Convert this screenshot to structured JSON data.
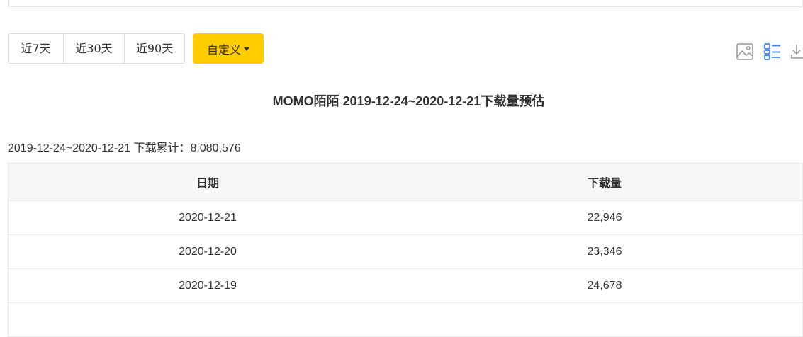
{
  "range_buttons": [
    "近7天",
    "近30天",
    "近90天"
  ],
  "custom_button": {
    "label": "自定义"
  },
  "toolbar": {
    "icons": [
      "image-icon",
      "list-view-icon",
      "download-icon"
    ],
    "active_color": "#3b82f6",
    "icon_color": "#999999"
  },
  "title": "MOMO陌陌 2019-12-24~2020-12-21下载量预估",
  "summary": "2019-12-24~2020-12-21 下载累计：8,080,576",
  "table": {
    "headers": [
      "日期",
      "下载量"
    ],
    "rows": [
      {
        "date": "2020-12-21",
        "downloads": "22,946"
      },
      {
        "date": "2020-12-20",
        "downloads": "23,346"
      },
      {
        "date": "2020-12-19",
        "downloads": "24,678"
      },
      {
        "date": "",
        "downloads": ""
      }
    ]
  },
  "colors": {
    "accent": "#ffcc00",
    "header_bg": "#f7f7f7",
    "border": "#e8e8e8"
  }
}
